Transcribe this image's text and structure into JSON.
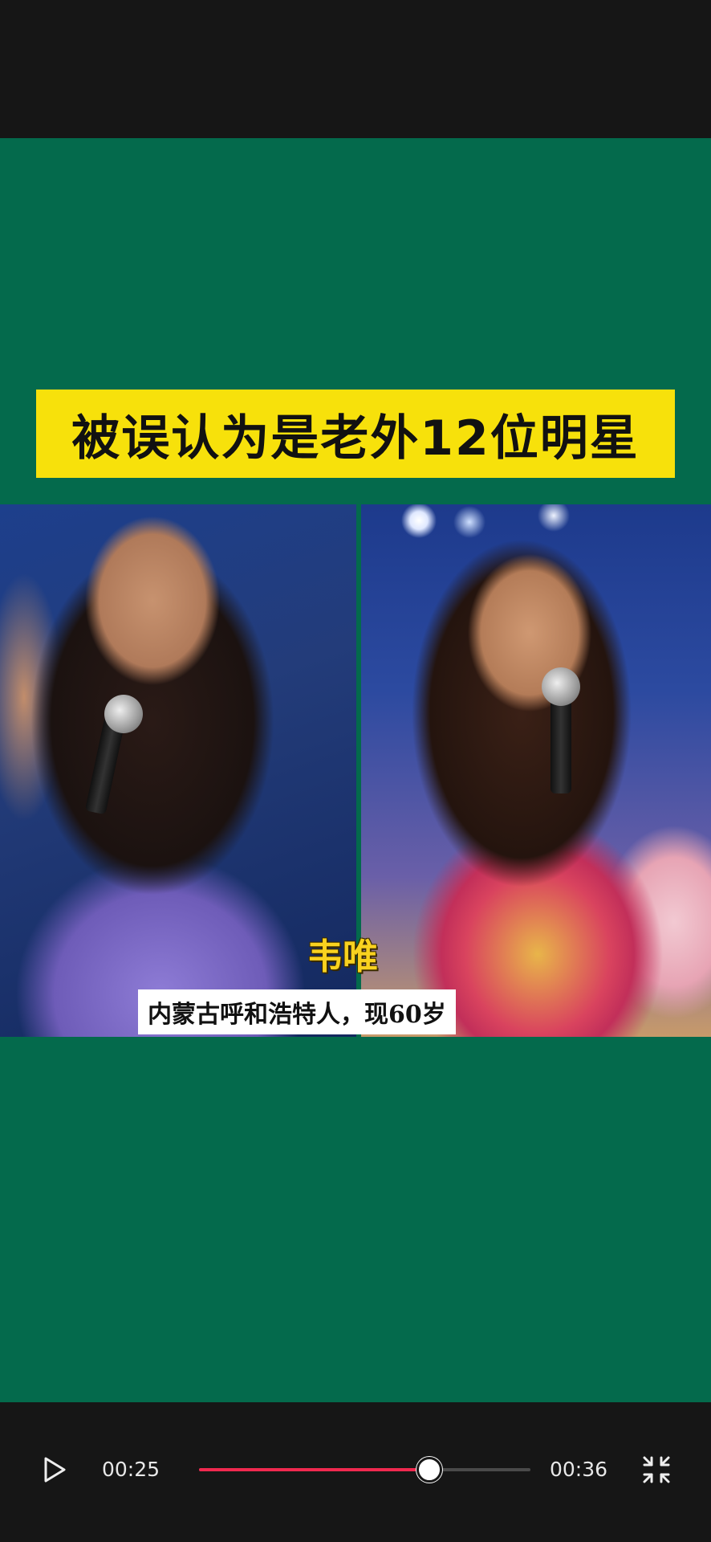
{
  "video": {
    "title": "被误认为是老外12位明星",
    "caption_name": "韦唯",
    "caption_desc": "内蒙古呼和浩特人，现60岁"
  },
  "player": {
    "current_time": "00:25",
    "total_time": "00:36",
    "progress_fraction": 0.694,
    "progress_color": "#f0294f",
    "play_icon": "play-icon",
    "fullscreen_icon": "exit-fullscreen-icon"
  },
  "colors": {
    "video_background": "#046a4c",
    "banner": "#f7e10b",
    "caption_name": "#f9d21f",
    "chrome": "#161616"
  }
}
